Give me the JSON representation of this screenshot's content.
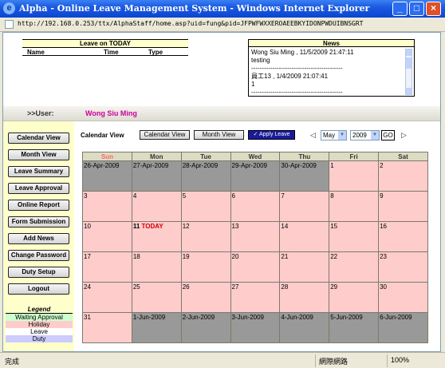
{
  "window": {
    "title": "Alpha - Online Leave Management System - Windows Internet Explorer",
    "url": "http://192.168.0.253/ttx/AlphaStaff/home.asp?uid=fung&pid=JFPWFWXXEROAEEBKYIDONPWDUIBNSGRT"
  },
  "leave_today": {
    "title": "Leave on TODAY",
    "col_name": "Name",
    "col_time": "Time",
    "col_type": "Type"
  },
  "news": {
    "title": "News",
    "line1": "Wong Siu Ming , 11/5/2009 21:47:11",
    "line2": "testing",
    "sep1": "-------------------------------------------",
    "line3": "員工13 , 1/4/2009 21:07:41",
    "line4": "1",
    "sep2": "-------------------------------------------"
  },
  "user": {
    "label": ">>User:",
    "name": "Wong Siu Ming"
  },
  "sidebar": {
    "buttons": [
      "Calendar View",
      "Month View",
      "Leave Summary",
      "Leave Approval",
      "Online Report",
      "Form Submission",
      "Add News",
      "Change Password",
      "Duty Setup",
      "Logout"
    ]
  },
  "legend": {
    "title": "Legend",
    "items": [
      {
        "label": "Waiting Approval",
        "color": "#ccffcc"
      },
      {
        "label": "Holiday",
        "color": "#ffcccc"
      },
      {
        "label": "Leave",
        "color": "#ffffff"
      },
      {
        "label": "Duty",
        "color": "#ccccff"
      }
    ]
  },
  "toolbar": {
    "title": "Calendar View",
    "calendar_view_btn": "Calendar View",
    "month_view_btn": "Month View",
    "apply_leave_btn": "Apply Leave",
    "prev_arrow": "◁",
    "next_arrow": "▷",
    "month": "May",
    "year": "2009",
    "go": "GO"
  },
  "calendar": {
    "days": [
      "Sun",
      "Mon",
      "Tue",
      "Wed",
      "Thu",
      "Fri",
      "Sat"
    ],
    "today_label": "TODAY",
    "weeks": [
      [
        {
          "d": "26-Apr-2009",
          "g": true
        },
        {
          "d": "27-Apr-2009",
          "g": true
        },
        {
          "d": "28-Apr-2009",
          "g": true
        },
        {
          "d": "29-Apr-2009",
          "g": true
        },
        {
          "d": "30-Apr-2009",
          "g": true
        },
        {
          "d": "1",
          "g": false
        },
        {
          "d": "2",
          "g": false
        }
      ],
      [
        {
          "d": "3",
          "g": false
        },
        {
          "d": "4",
          "g": false
        },
        {
          "d": "5",
          "g": false
        },
        {
          "d": "6",
          "g": false
        },
        {
          "d": "7",
          "g": false
        },
        {
          "d": "8",
          "g": false
        },
        {
          "d": "9",
          "g": false
        }
      ],
      [
        {
          "d": "10",
          "g": false
        },
        {
          "d": "11",
          "g": false,
          "today": true
        },
        {
          "d": "12",
          "g": false
        },
        {
          "d": "13",
          "g": false
        },
        {
          "d": "14",
          "g": false
        },
        {
          "d": "15",
          "g": false
        },
        {
          "d": "16",
          "g": false
        }
      ],
      [
        {
          "d": "17",
          "g": false
        },
        {
          "d": "18",
          "g": false
        },
        {
          "d": "19",
          "g": false
        },
        {
          "d": "20",
          "g": false
        },
        {
          "d": "21",
          "g": false
        },
        {
          "d": "22",
          "g": false
        },
        {
          "d": "23",
          "g": false
        }
      ],
      [
        {
          "d": "24",
          "g": false
        },
        {
          "d": "25",
          "g": false
        },
        {
          "d": "26",
          "g": false
        },
        {
          "d": "27",
          "g": false
        },
        {
          "d": "28",
          "g": false
        },
        {
          "d": "29",
          "g": false
        },
        {
          "d": "30",
          "g": false
        }
      ],
      [
        {
          "d": "31",
          "g": false
        },
        {
          "d": "1-Jun-2009",
          "g": true
        },
        {
          "d": "2-Jun-2009",
          "g": true
        },
        {
          "d": "3-Jun-2009",
          "g": true
        },
        {
          "d": "4-Jun-2009",
          "g": true
        },
        {
          "d": "5-Jun-2009",
          "g": true
        },
        {
          "d": "6-Jun-2009",
          "g": true
        }
      ]
    ]
  },
  "status": {
    "done": "完成",
    "zone": "網際網路",
    "zoom": "100%"
  }
}
